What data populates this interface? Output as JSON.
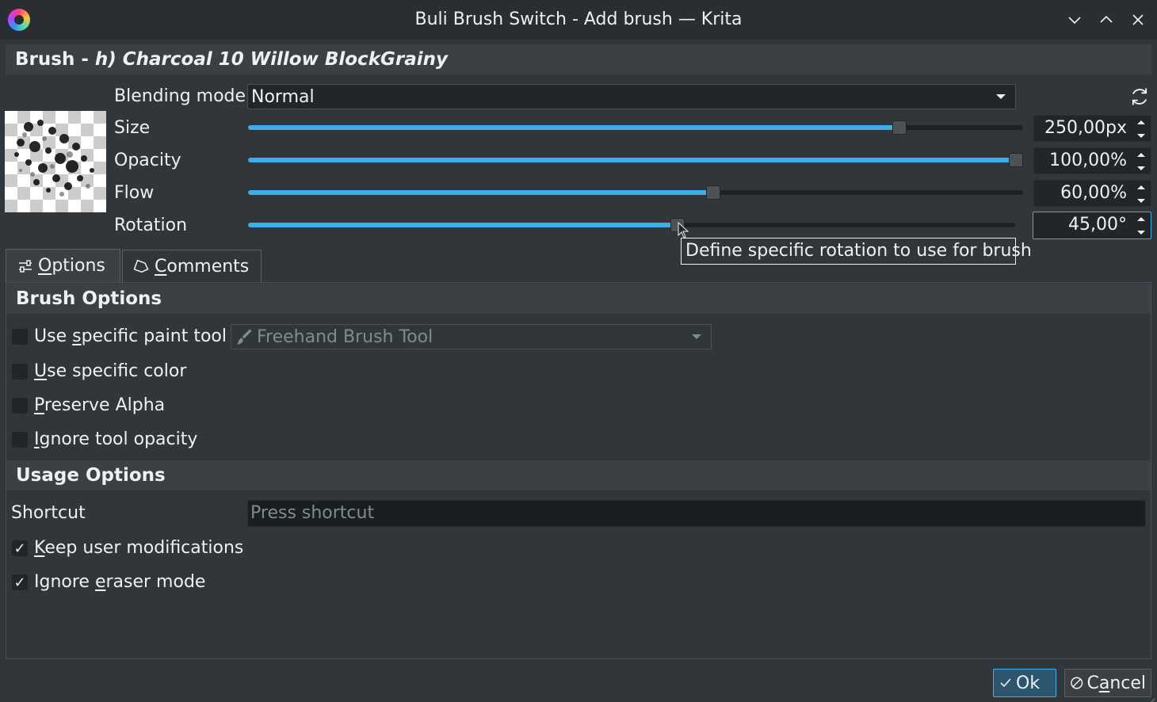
{
  "window": {
    "title": "Buli Brush Switch - Add brush — Krita",
    "controls": [
      "chevron-down",
      "chevron-up",
      "close"
    ]
  },
  "header": {
    "prefix": "Brush -",
    "brush_name": "h) Charcoal 10 Willow BlockGrainy"
  },
  "blending": {
    "label": "Blending mode",
    "value": "Normal"
  },
  "sliders": {
    "size": {
      "label": "Size",
      "value_text": "250,00px",
      "fraction": 0.84
    },
    "opacity": {
      "label": "Opacity",
      "value_text": "100,00%",
      "fraction": 1.0
    },
    "flow": {
      "label": "Flow",
      "value_text": "60,00%",
      "fraction": 0.6
    },
    "rotation": {
      "label": "Rotation",
      "value_text": "45,00°",
      "fraction": 0.56
    }
  },
  "tooltip": "Define specific rotation to use for brush",
  "tabs": [
    {
      "label": "Options",
      "mnemonic": "O",
      "rest": "ptions",
      "icon": "sliders-icon",
      "active": true
    },
    {
      "label": "Comments",
      "mnemonic": "C",
      "rest": "omments",
      "icon": "tag-icon",
      "active": false
    }
  ],
  "brush_options": {
    "title": "Brush Options",
    "paint_tool": {
      "label_pre": "Use ",
      "mnemonic": "s",
      "label_post": "pecific paint tool",
      "checked": false,
      "tool": "Freehand Brush Tool"
    },
    "color": {
      "label_pre": "",
      "mnemonic": "U",
      "label_post": "se specific color",
      "checked": false
    },
    "alpha": {
      "label_pre": "",
      "mnemonic": "P",
      "label_post": "reserve Alpha",
      "checked": false
    },
    "opacity": {
      "label_pre": "",
      "mnemonic": "I",
      "label_post": "gnore tool opacity",
      "checked": false
    }
  },
  "usage_options": {
    "title": "Usage Options",
    "shortcut_label": "Shortcut",
    "shortcut_placeholder": "Press shortcut",
    "keep_mods": {
      "label_pre": "",
      "mnemonic": "K",
      "label_post": "eep user modifications",
      "checked": true
    },
    "ignore_eraser": {
      "label_pre": "Ignore ",
      "mnemonic": "e",
      "label_post": "raser mode",
      "checked": true
    }
  },
  "buttons": {
    "ok": "Ok",
    "cancel_pre": "C",
    "cancel_mnemonic": "a",
    "cancel_post": "ncel"
  },
  "colors": {
    "accent": "#3daee9",
    "background": "#31363b",
    "titlebar": "#2a2e32"
  }
}
